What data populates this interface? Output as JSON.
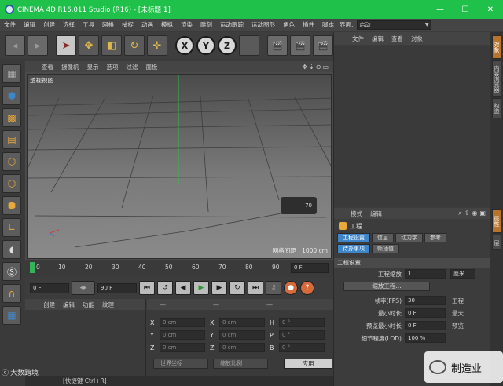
{
  "window": {
    "title": "CINEMA 4D R16.011 Studio (R16) - [未标题 1]",
    "min": "—",
    "max": "☐",
    "close": "✕"
  },
  "menu": {
    "items": [
      "文件",
      "编辑",
      "创建",
      "选择",
      "工具",
      "网格",
      "捕捉",
      "动画",
      "模拟",
      "渲染",
      "雕刻",
      "运动跟踪",
      "运动图形",
      "角色",
      "插件",
      "脚本"
    ],
    "layout_label": "界面:",
    "layout_value": "启动"
  },
  "toolbar": {
    "x": "X",
    "y": "Y",
    "z": "Z"
  },
  "viewport": {
    "menu": [
      "查看",
      "摄像机",
      "显示",
      "选项",
      "过滤",
      "面板"
    ],
    "label": "透视视图",
    "grid_info": "网格间距 : 1000 cm",
    "hud_value": "70"
  },
  "timeline": {
    "ticks": [
      "0",
      "10",
      "20",
      "30",
      "40",
      "50",
      "60",
      "70",
      "80",
      "90"
    ],
    "frame_field": "0 F"
  },
  "transport": {
    "start": "0 F",
    "end": "90 F"
  },
  "materials": {
    "menu": [
      "创建",
      "编辑",
      "功能",
      "纹理"
    ]
  },
  "coords": {
    "head": [
      "—",
      "—",
      "—"
    ],
    "rows": [
      [
        {
          "ax": "X",
          "val": "0 cm"
        },
        {
          "ax": "X",
          "val": "0 cm"
        },
        {
          "ax": "H",
          "val": "0 °"
        }
      ],
      [
        {
          "ax": "Y",
          "val": "0 cm"
        },
        {
          "ax": "Y",
          "val": "0 cm"
        },
        {
          "ax": "P",
          "val": "0 °"
        }
      ],
      [
        {
          "ax": "Z",
          "val": "0 cm"
        },
        {
          "ax": "Z",
          "val": "0 cm"
        },
        {
          "ax": "B",
          "val": "0 °"
        }
      ]
    ],
    "world": "世界坐标",
    "scale": "缩放比例",
    "apply": "应用"
  },
  "status": {
    "text": "[快捷键 Ctrl+R]"
  },
  "objects": {
    "menu": [
      "文件",
      "编辑",
      "查看",
      "对象"
    ]
  },
  "attributes": {
    "menu": [
      "模式",
      "编辑"
    ],
    "project": "工程",
    "tabs": [
      "工程设置",
      "信息",
      "动力学",
      "参考",
      "待办事项",
      "帧插值"
    ],
    "section": "工程设置",
    "scale_label": "工程缩放",
    "scale_value": "1",
    "scale_unit": "厘米",
    "scale_button": "缩放工程...",
    "rows": [
      {
        "label": "帧率(FPS)",
        "value": "30",
        "extra": "工程"
      },
      {
        "label": "最小时长",
        "value": "0 F",
        "extra": "最大"
      },
      {
        "label": "预览最小时长",
        "value": "0 F",
        "extra": "预览"
      },
      {
        "label": "细节程度(LOD)",
        "value": "100 %",
        "extra": ""
      }
    ]
  },
  "side_tabs": [
    "对象",
    "内容浏览器",
    "构造",
    "属性",
    "层"
  ],
  "watermark": {
    "left": "大数跨境",
    "right": "制造业"
  }
}
